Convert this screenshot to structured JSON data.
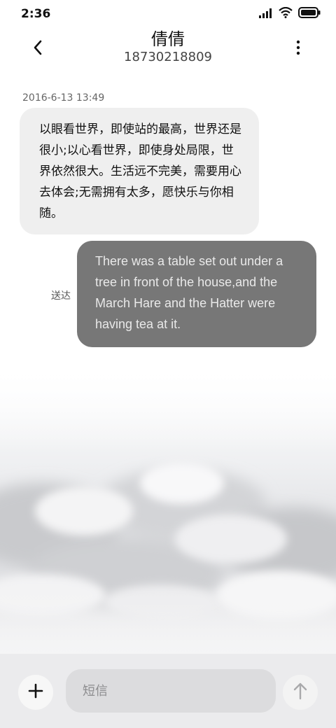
{
  "status_bar": {
    "time": "2:36",
    "icons": [
      "signal-icon",
      "wifi-icon",
      "battery-icon"
    ]
  },
  "header": {
    "contact_name": "倩倩",
    "contact_number": "18730218809",
    "icons": [
      "back-arrow-icon",
      "more-vertical-icon"
    ]
  },
  "conversation": {
    "timestamp": "2016-6-13 13:49",
    "incoming_message": "以眼看世界，即使站的最高，世界还是很小;以心看世界，即使身处局限，世界依然很大。生活远不完美，需要用心去体会;无需拥有太多，愿快乐与你相随。",
    "outgoing_message": "There was a table set out under a tree in front of the house,and the March Hare and the Hatter were having tea at it.",
    "outgoing_status": "送达"
  },
  "composer": {
    "placeholder": "短信",
    "value": "",
    "icons": [
      "plus-icon",
      "send-arrow-icon"
    ]
  },
  "colors": {
    "incoming_bubble": "#efefef",
    "outgoing_bubble": "#777777",
    "input_bar": "#ebebed"
  }
}
